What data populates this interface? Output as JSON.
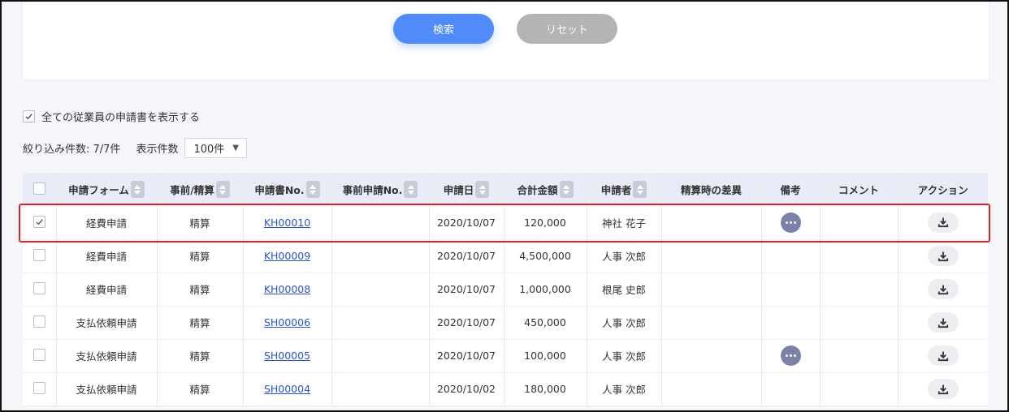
{
  "search": {
    "search_label": "検索",
    "reset_label": "リセット"
  },
  "show_all": {
    "label": "全ての従業員の申請書を表示する",
    "checked": true
  },
  "filter": {
    "count_label": "絞り込み件数: 7/7件",
    "display_label": "表示件数",
    "per_page": "100件"
  },
  "table": {
    "headers": [
      "申請フォーム",
      "事前/精算",
      "申請書No.",
      "事前申請No.",
      "申請日",
      "合計金額",
      "申請者",
      "精算時の差異",
      "備考",
      "コメント",
      "アクション"
    ],
    "rows": [
      {
        "form": "経費申請",
        "type": "精算",
        "no": "KH00010",
        "pre_no": "",
        "date": "2020/10/07",
        "amount": "120,000",
        "applicant": "神社 花子",
        "checked": true,
        "note": true
      },
      {
        "form": "経費申請",
        "type": "精算",
        "no": "KH00009",
        "pre_no": "",
        "date": "2020/10/07",
        "amount": "4,500,000",
        "applicant": "人事 次郎",
        "checked": false,
        "note": false
      },
      {
        "form": "経費申請",
        "type": "精算",
        "no": "KH00008",
        "pre_no": "",
        "date": "2020/10/07",
        "amount": "1,000,000",
        "applicant": "根尾 史郎",
        "checked": false,
        "note": false
      },
      {
        "form": "支払依頼申請",
        "type": "精算",
        "no": "SH00006",
        "pre_no": "",
        "date": "2020/10/07",
        "amount": "450,000",
        "applicant": "人事 次郎",
        "checked": false,
        "note": false
      },
      {
        "form": "支払依頼申請",
        "type": "精算",
        "no": "SH00005",
        "pre_no": "",
        "date": "2020/10/07",
        "amount": "100,000",
        "applicant": "人事 次郎",
        "checked": false,
        "note": true
      },
      {
        "form": "支払依頼申請",
        "type": "精算",
        "no": "SH00004",
        "pre_no": "",
        "date": "2020/10/02",
        "amount": "180,000",
        "applicant": "人事 次郎",
        "checked": false,
        "note": false
      }
    ]
  },
  "colors": {
    "primary": "#4f8bf9",
    "reset": "#b4b4b4",
    "highlight": "#d9232d",
    "header_bg": "#e9ecf7",
    "note_icon": "#7a82a8"
  }
}
